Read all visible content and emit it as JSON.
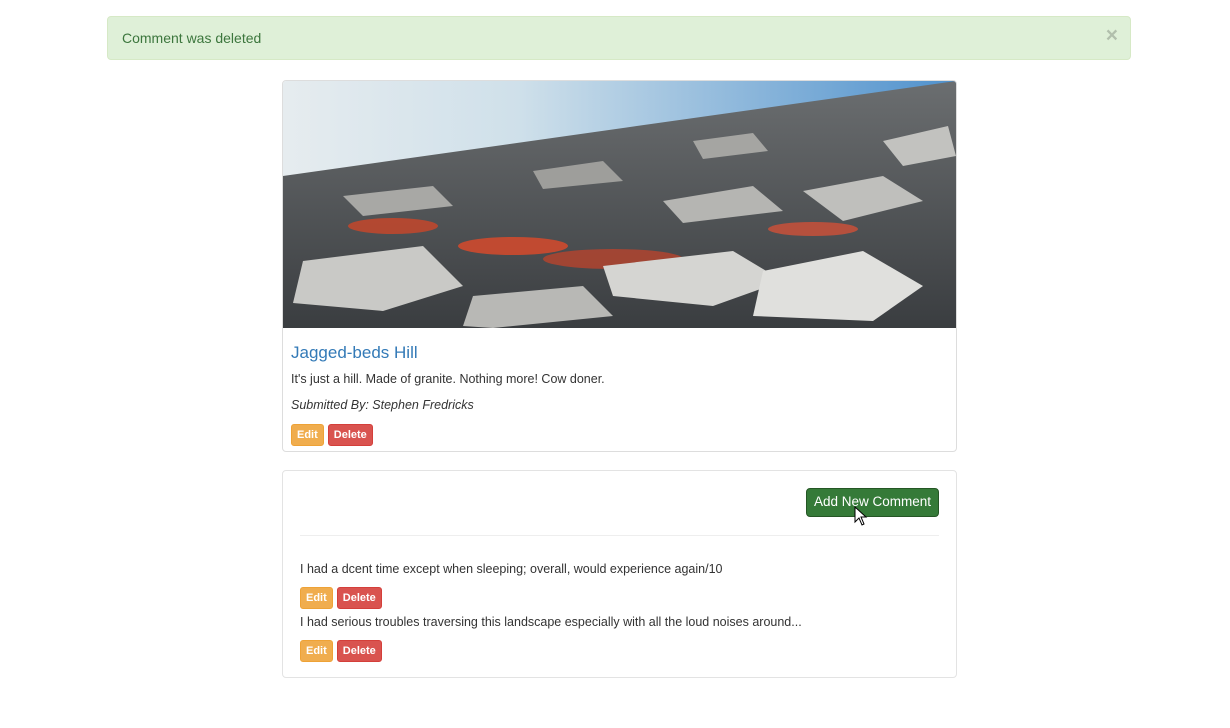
{
  "alert": {
    "message": "Comment was deleted",
    "close_symbol": "×"
  },
  "campground": {
    "name": "Jagged-beds Hill",
    "description": "It's just a hill. Made of granite. Nothing more! Cow doner.",
    "submitted_by": "Submitted By: Stephen Fredricks",
    "edit_label": "Edit",
    "delete_label": "Delete",
    "image_alt": "rocky hillside with red shrubs"
  },
  "comments_section": {
    "add_button_label": "Add New Comment",
    "comments": [
      {
        "text": "I had a dcent time except when sleeping; overall, would experience again/10",
        "edit_label": "Edit",
        "delete_label": "Delete"
      },
      {
        "text": "I had serious troubles traversing this landscape especially with all the loud noises around...",
        "edit_label": "Edit",
        "delete_label": "Delete"
      }
    ]
  },
  "colors": {
    "alert_bg": "#dff0d8",
    "alert_text": "#3c763d",
    "link": "#337ab7",
    "warning": "#f0ad4e",
    "danger": "#d9534f",
    "success": "#357a38"
  },
  "icons": [
    "close-icon",
    "mouse-cursor-icon"
  ]
}
